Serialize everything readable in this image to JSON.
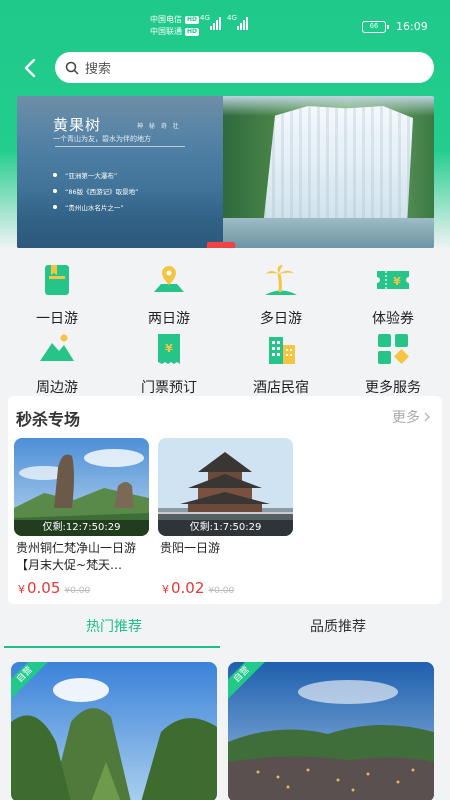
{
  "status_bar": {
    "carrier_1": "中国电信",
    "carrier_2": "中国联通",
    "hd_1": "HD",
    "hd_2": "HD",
    "network_1": "4G",
    "network_2": "4G",
    "battery": "66",
    "time": "16:09"
  },
  "search": {
    "placeholder": "搜索"
  },
  "banner": {
    "title": "黄果树",
    "tag": "神 秘 奇 壮",
    "subtitle": "一个青山为友，碧水为伴的地方",
    "bullets": [
      "“亚洲第一大瀑布”",
      "“86版《西游记》取景地”",
      "“贵州山水名片之一”"
    ]
  },
  "categories": [
    {
      "label": "一日游",
      "icon": "book-icon"
    },
    {
      "label": "两日游",
      "icon": "map-pin-icon"
    },
    {
      "label": "多日游",
      "icon": "palm-tree-icon"
    },
    {
      "label": "体验券",
      "icon": "voucher-icon"
    },
    {
      "label": "周边游",
      "icon": "mountain-icon"
    },
    {
      "label": "门票预订",
      "icon": "ticket-icon"
    },
    {
      "label": "酒店民宿",
      "icon": "hotel-icon"
    },
    {
      "label": "更多服务",
      "icon": "grid-icon"
    }
  ],
  "flash_sale": {
    "title": "秒杀专场",
    "more": "更多",
    "products": [
      {
        "timer": "仅剩:12:7:50:29",
        "name": "贵州铜仁梵净山一日游【月末大促~梵天…",
        "currency": "¥",
        "price": "0.05",
        "original": "¥0.00"
      },
      {
        "timer": "仅剩:1:7:50:29",
        "name": "贵阳一日游",
        "currency": "¥",
        "price": "0.02",
        "original": "¥0.00"
      }
    ]
  },
  "tabs": [
    {
      "label": "热门推荐",
      "active": true
    },
    {
      "label": "品质推荐",
      "active": false
    }
  ],
  "recommendations": [
    {
      "tag": "自营"
    },
    {
      "tag": "自营"
    }
  ],
  "colors": {
    "brand": "#1fc98a",
    "price": "#e53935"
  }
}
